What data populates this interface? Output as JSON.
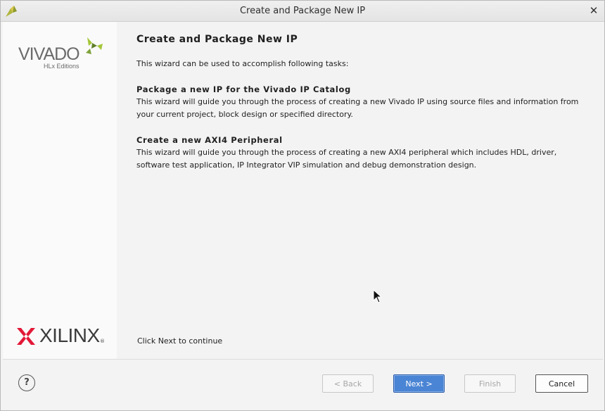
{
  "window": {
    "title": "Create and Package New IP"
  },
  "sidebar": {
    "vivado_logo_text": "VIVADO",
    "vivado_logo_subtitle": "HLx Editions",
    "xilinx_logo_text": "XILINX",
    "xilinx_logo_mark": "®"
  },
  "content": {
    "heading": "Create and Package New IP",
    "intro": "This wizard can be used to accomplish following tasks:",
    "sections": [
      {
        "title": "Package a new IP for the Vivado IP Catalog",
        "description": "This wizard will guide you through the process of creating a new Vivado IP using source files and information from your current project, block design or specified directory."
      },
      {
        "title": "Create a new AXI4 Peripheral",
        "description": "This wizard will guide you through the process of creating a new AXI4 peripheral which includes HDL, driver, software test application, IP Integrator VIP simulation and debug demonstration design."
      }
    ],
    "footer_hint": "Click Next to continue"
  },
  "buttons": {
    "help": "?",
    "back": "< Back",
    "next": "Next >",
    "finish": "Finish",
    "cancel": "Cancel"
  },
  "icons": {
    "close": "close-icon",
    "help": "help-icon",
    "app": "vivado-app-icon"
  },
  "colors": {
    "accent": "#4a84d4",
    "vivado_green": "#a4c639",
    "xilinx_red": "#e31837"
  }
}
